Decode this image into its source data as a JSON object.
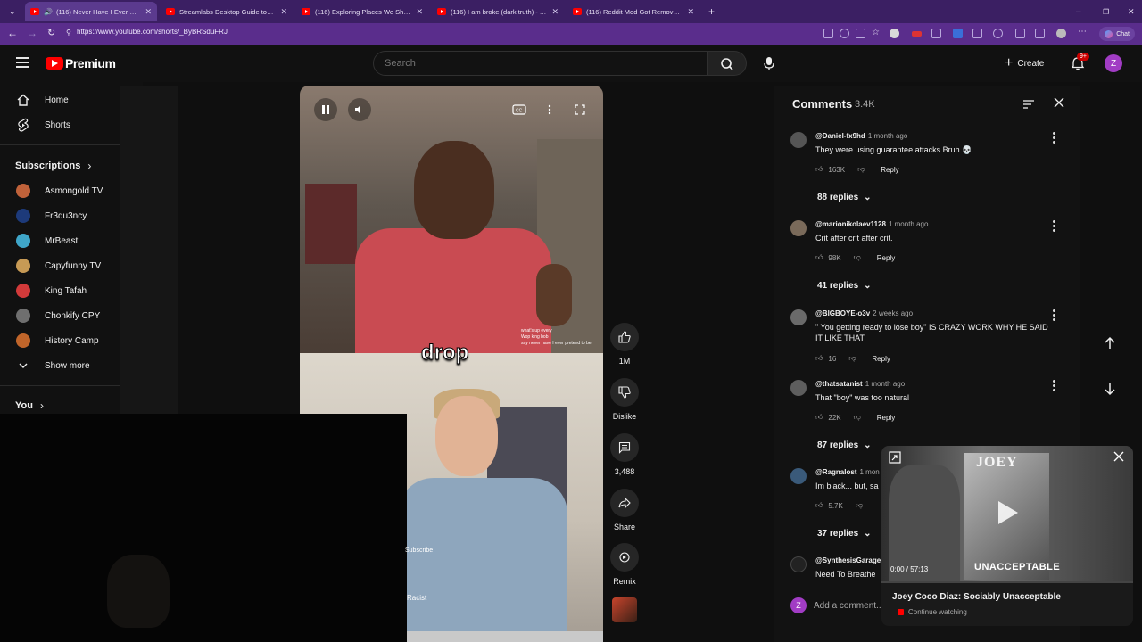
{
  "browser": {
    "tabs": [
      {
        "title": "(116) Never Have I Ever Gone",
        "active": true
      },
      {
        "title": "Streamlabs Desktop Guide to BEST",
        "active": false
      },
      {
        "title": "(116) Exploring Places We Shouldn't",
        "active": false
      },
      {
        "title": "(116) I am broke (dark truth) - You",
        "active": false
      },
      {
        "title": "(116) Reddit Mod Got Removed a",
        "active": false
      }
    ],
    "url": "https://www.youtube.com/shorts/_ByBRSduFRJ",
    "chat_label": "Chat"
  },
  "header": {
    "logo": "Premium",
    "search_placeholder": "Search",
    "create_label": "Create",
    "notification_count": "9+",
    "avatar_letter": "Z"
  },
  "sidebar": {
    "home": "Home",
    "shorts": "Shorts",
    "subscriptions_heading": "Subscriptions",
    "subscriptions": [
      {
        "name": "Asmongold TV",
        "color": "#c0623a"
      },
      {
        "name": "Fr3qu3ncy",
        "color": "#1d3a7a"
      },
      {
        "name": "MrBeast",
        "color": "#3fa6c9"
      },
      {
        "name": "Capyfunny TV",
        "color": "#c79a55"
      },
      {
        "name": "King Tafah",
        "color": "#d23a3a"
      },
      {
        "name": "Chonkify CPY",
        "color": "#6f6f6f"
      },
      {
        "name": "History Camp",
        "color": "#c0652a"
      }
    ],
    "show_more": "Show more",
    "you_heading": "You"
  },
  "video": {
    "caption": "drop",
    "subscribe_label": "Subscribe",
    "chat_lines": [
      "what's up every",
      "Wop king bob",
      "say never have I ever pretend to be"
    ],
    "bottom_text": "Racist"
  },
  "actions": {
    "like_count": "1M",
    "dislike_label": "Dislike",
    "comments_count": "3,488",
    "share_label": "Share",
    "remix_label": "Remix"
  },
  "comments": {
    "title": "Comments",
    "count": "3.4K",
    "items": [
      {
        "author": "@Daniel-fx9hd",
        "time": "1 month ago",
        "text": "They were using guarantee attacks Bruh 💀",
        "likes": "163K",
        "replies": "88 replies",
        "avatar_color": "#555"
      },
      {
        "author": "@marionikolaev1128",
        "time": "1 month ago",
        "text": "Crit after crit after crit.",
        "likes": "98K",
        "replies": "41 replies",
        "avatar_color": "#7a6a5a"
      },
      {
        "author": "@BIGBOYE-o3v",
        "time": "2 weeks ago",
        "text": "\" You getting ready to lose boy\" IS CRAZY WORK WHY HE SAID IT LIKE THAT",
        "likes": "16",
        "replies": "",
        "avatar_color": "#6a6a6a"
      },
      {
        "author": "@thatsatanist",
        "time": "1 month ago",
        "text": "That \"boy\" was too natural",
        "likes": "22K",
        "replies": "87 replies",
        "avatar_color": "#5e5e5e"
      },
      {
        "author": "@Ragnalost",
        "time": "1 mon",
        "text": "Im black... but, sa",
        "likes": "5.7K",
        "replies": "37 replies",
        "avatar_color": "#3a5a7a"
      },
      {
        "author": "@SynthesisGarage",
        "time": "",
        "text": "Need To Breathe",
        "likes": "",
        "replies": "",
        "avatar_color": "#222"
      }
    ],
    "reply_label": "Reply",
    "add_placeholder": "Add a comment...",
    "add_avatar_letter": "Z"
  },
  "miniplayer": {
    "brand": "JOEY COCO DIAZ",
    "brand_top": "JOEY",
    "brand_bottom": "UNACCEPTABLE",
    "time": "0:00 / 57:13",
    "title": "Joey Coco Diaz: Sociably Unacceptable",
    "subtitle": "Continue watching"
  }
}
